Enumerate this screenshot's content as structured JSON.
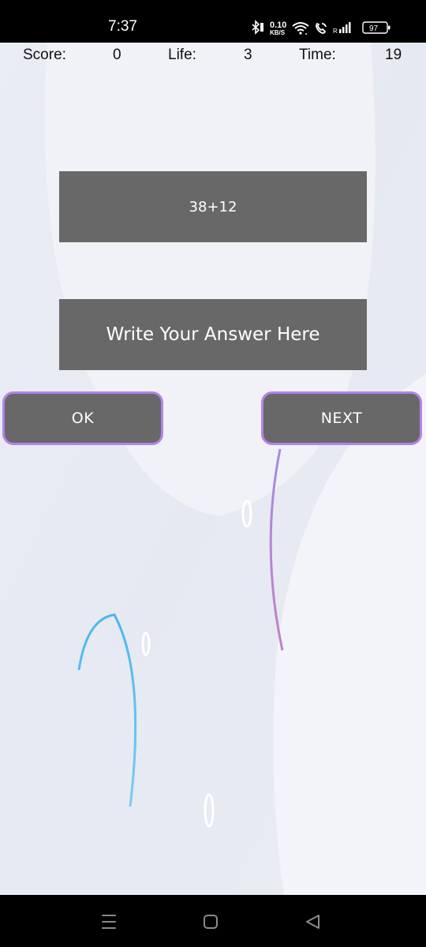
{
  "status_bar": {
    "time": "7:37",
    "network_speed_value": "0.10",
    "network_speed_unit": "KB/S",
    "battery": "97",
    "icons": [
      "bluetooth-icon",
      "wifi-icon",
      "wifi-call-icon",
      "signal-icon",
      "battery-icon"
    ]
  },
  "hud": {
    "score_label": "Score:",
    "score_value": "0",
    "life_label": "Life:",
    "life_value": "3",
    "time_label": "Time:",
    "time_value": "19"
  },
  "question": {
    "text": "38+12"
  },
  "answer": {
    "placeholder": "Write Your Answer Here",
    "value": ""
  },
  "buttons": {
    "ok_label": "OK",
    "next_label": "NEXT"
  },
  "colors": {
    "box_bg": "#686868",
    "button_border": "#b383e8",
    "background": "#eef0f6"
  },
  "nav_bar": {
    "icons": [
      "menu-icon",
      "home-icon",
      "back-icon"
    ]
  }
}
